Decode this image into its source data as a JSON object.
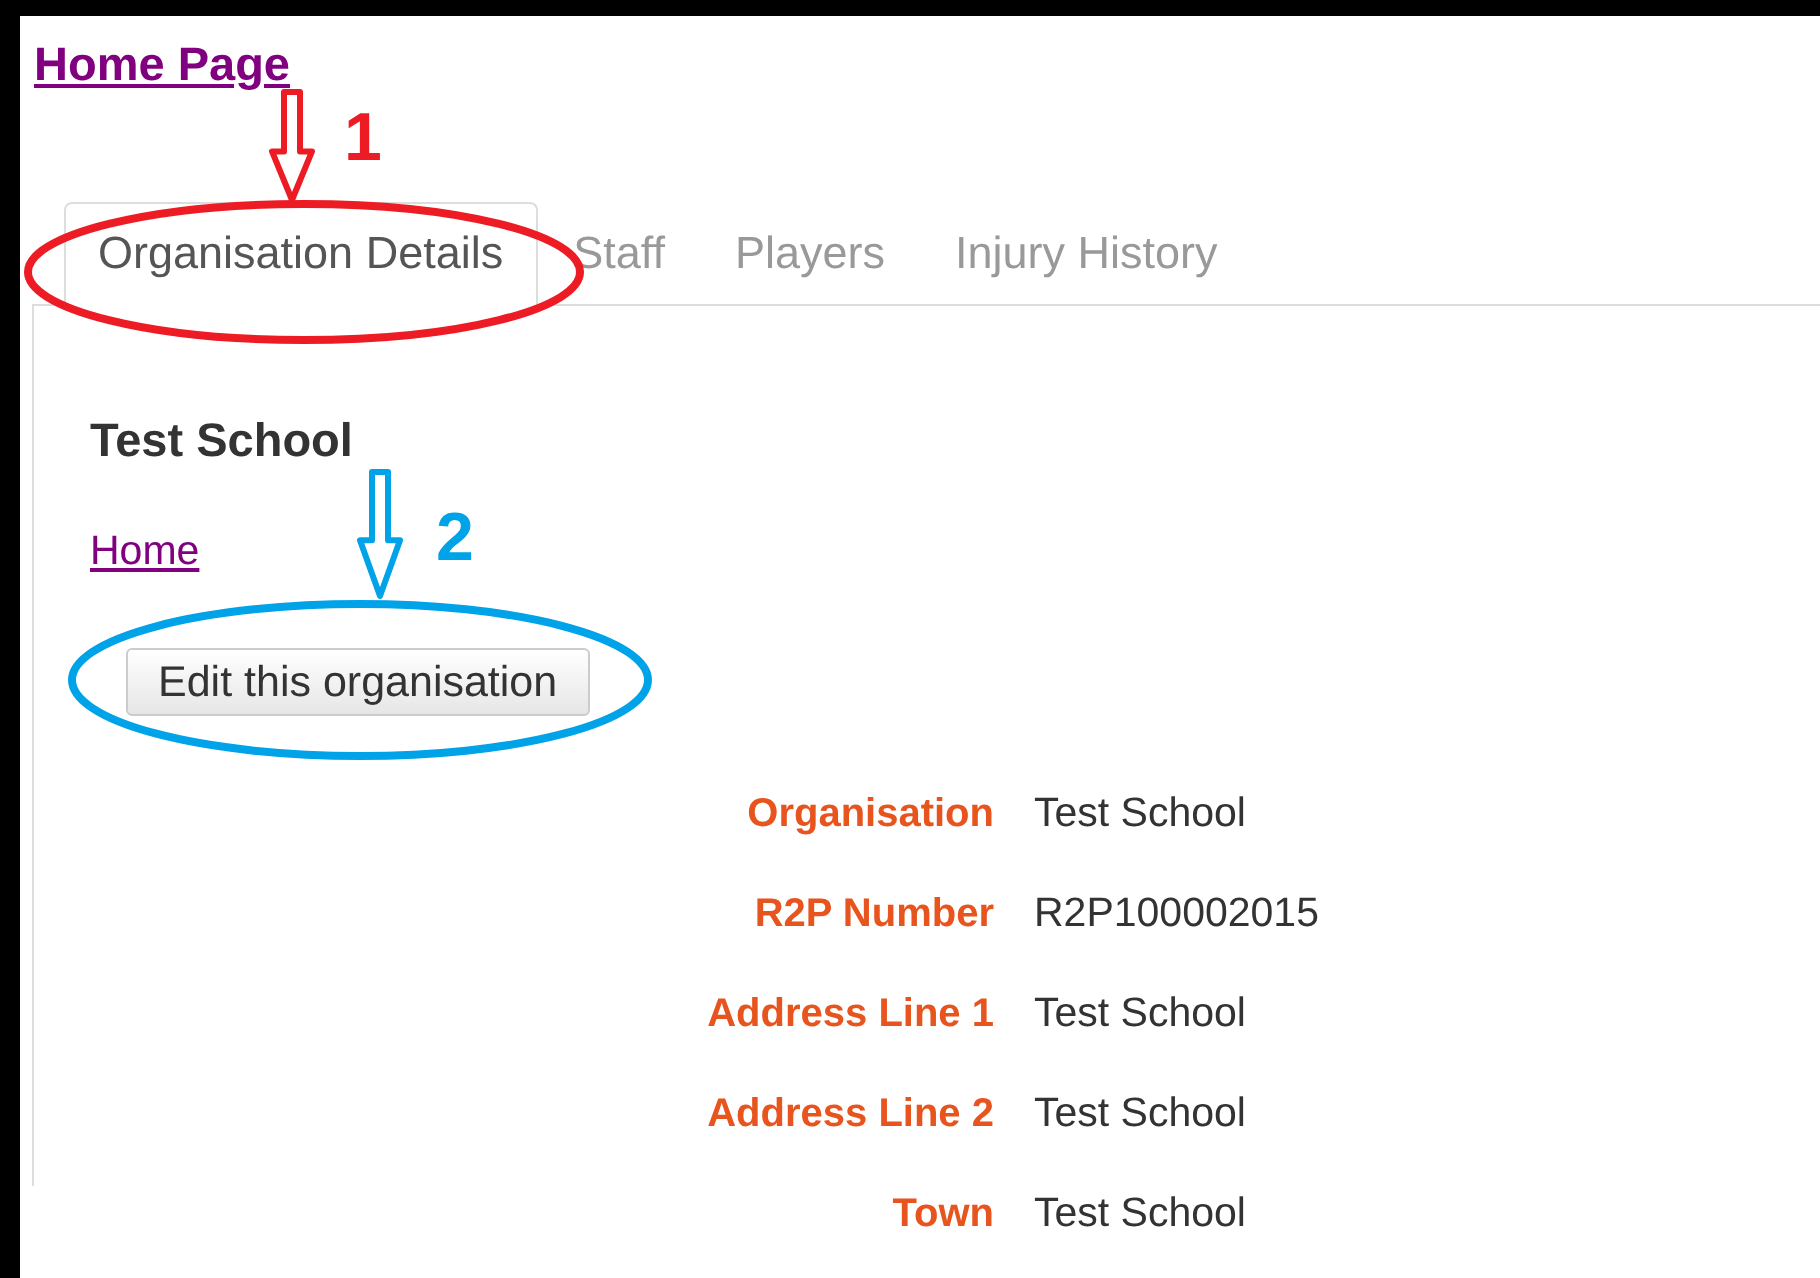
{
  "top_link": "Home Page",
  "tabs": [
    {
      "label": "Organisation Details",
      "selected": true
    },
    {
      "label": "Staff",
      "selected": false
    },
    {
      "label": "Players",
      "selected": false
    },
    {
      "label": "Injury History",
      "selected": false
    }
  ],
  "heading": "Test School",
  "breadcrumb_link": "Home",
  "edit_button": "Edit this organisation",
  "details": [
    {
      "label": "Organisation",
      "value": "Test School"
    },
    {
      "label": "R2P Number",
      "value": "R2P100002015"
    },
    {
      "label": "Address Line 1",
      "value": "Test School"
    },
    {
      "label": "Address Line 2",
      "value": "Test School"
    },
    {
      "label": "Town",
      "value": "Test School"
    }
  ],
  "annotations": [
    {
      "number": "1",
      "color": "#ed1c24"
    },
    {
      "number": "2",
      "color": "#00a2e8"
    }
  ]
}
